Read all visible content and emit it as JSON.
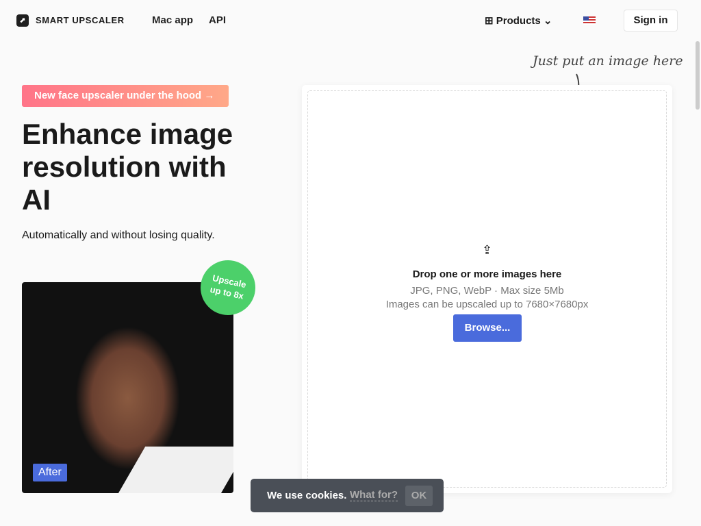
{
  "nav": {
    "brand": "SMART UPSCALER",
    "links": [
      "Mac app",
      "API"
    ],
    "products": "Products",
    "sign_in": "Sign in"
  },
  "hero": {
    "promo": "New face upscaler under the hood",
    "title": "Enhance image resolution with AI",
    "subtitle": "Automatically and without losing quality.",
    "badge_line1": "Upscale",
    "badge_line2": "up to 8x",
    "after_label": "After"
  },
  "upload": {
    "hint": "Just put an image here",
    "title": "Drop one or more images here",
    "formats": "JPG, PNG, WebP · Max size 5Mb",
    "limit": "Images can be upscaled up to 7680×7680px",
    "browse": "Browse..."
  },
  "cookie": {
    "text": "We use cookies.",
    "what_for": "What for?",
    "ok": "OK"
  },
  "colors": {
    "accent": "#4a6bdc",
    "badge": "#4cd06a"
  }
}
